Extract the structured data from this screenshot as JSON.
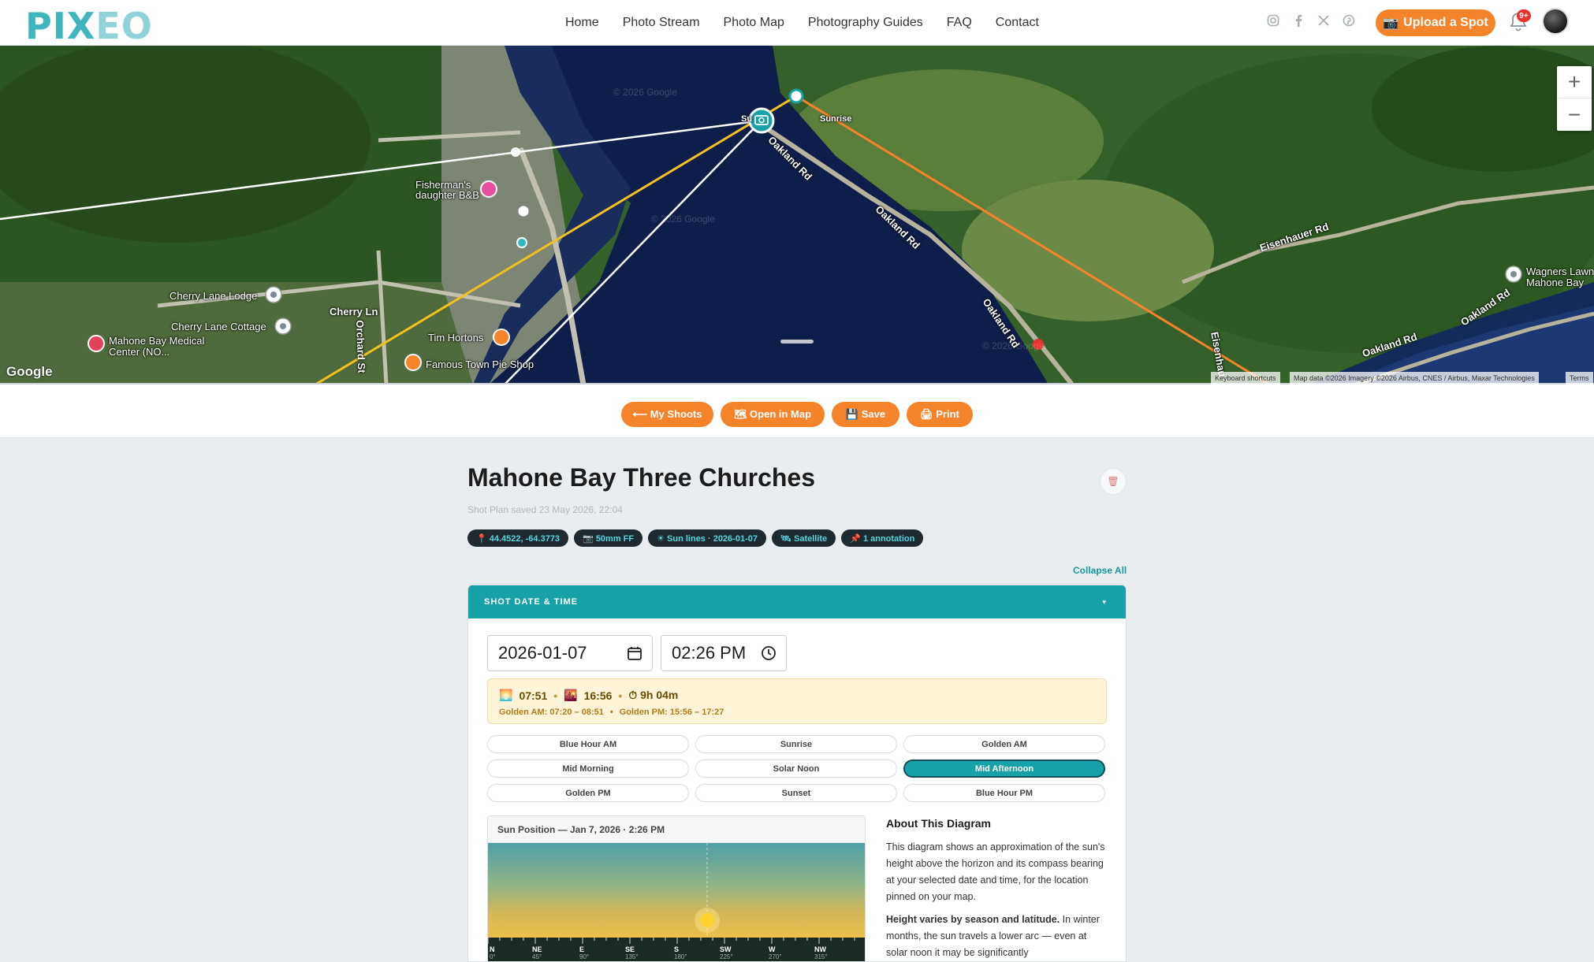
{
  "brand": {
    "logo_a": "PIX",
    "logo_b": "EO"
  },
  "nav": {
    "items": [
      "Home",
      "Photo Stream",
      "Photo Map",
      "Photography Guides",
      "FAQ",
      "Contact"
    ],
    "upload_label": "Upload a Spot",
    "notification_badge": "9+",
    "socials": [
      "instagram-icon",
      "facebook-icon",
      "x-icon",
      "pinterest-icon"
    ]
  },
  "map": {
    "labels": {
      "fishermans": "Fisherman's daughter B&B",
      "cherry_lodge": "Cherry Lane Lodge",
      "cherry_cottage": "Cherry Lane Cottage",
      "cherry_ln": "Cherry Ln",
      "orchard": "Orchard St",
      "medical": "Mahone Bay Medical Center (NO...",
      "tim": "Tim Hortons",
      "pie": "Famous Town Pie Shop",
      "sunrise": "Sunrise",
      "oakland1": "Oakland Rd",
      "oakland2": "Oakland Rd",
      "oakland3": "Oakland Rd",
      "oakland4": "Oakland Rd",
      "oakland5": "Oakland Rd",
      "eisenhauer": "Eisenhauer Rd",
      "eisenhau2": "Eisenhau",
      "wagners": "Wagners Lawn Mahone Bay",
      "sun": "Su",
      "watermark1": "© 2026 Google",
      "watermark2": "© 2026 Google",
      "watermark3": "© 2026 Google"
    },
    "google": "Google",
    "attribution": {
      "shortcuts": "Keyboard shortcuts",
      "data": "Map data ©2026 Imagery ©2026 Airbus, CNES / Airbus, Maxar Technologies",
      "terms": "Terms"
    },
    "zoom_in": "+",
    "zoom_out": "−"
  },
  "toolbar": {
    "my_shoots": "⟵ My Shoots",
    "open_map": "🗺 Open in Map",
    "save": "💾 Save",
    "print": "🖨 Print"
  },
  "plan": {
    "title": "Mahone Bay Three Churches",
    "saved": "Shot Plan saved 23 May 2026, 22:04",
    "chips": [
      "📍 44.4522, -64.3773",
      "📷 50mm FF",
      "☀ Sun lines · 2026-01-07",
      "🛰 Satellite",
      "📌 1 annotation"
    ],
    "collapse_all": "Collapse All"
  },
  "panel": {
    "heading": "SHOT DATE & TIME",
    "caret": "▾",
    "date": "2026-01-07",
    "time": "02:26 PM",
    "sunrise": "07:51",
    "sunset": "16:56",
    "daylength": "⏱ 9h 04m",
    "sep": "•",
    "golden_am": "Golden AM: 07:20 – 08:51",
    "golden_pm": "Golden PM: 15:56 – 17:27",
    "presets": [
      "Blue Hour AM",
      "Sunrise",
      "Golden AM",
      "Mid Morning",
      "Solar Noon",
      "Mid Afternoon",
      "Golden PM",
      "Sunset",
      "Blue Hour PM"
    ],
    "active_preset": "Mid Afternoon",
    "diagram_title": "Sun Position — Jan 7, 2026 · 2:26 PM",
    "compass": [
      {
        "dir": "N",
        "deg": "0°"
      },
      {
        "dir": "NE",
        "deg": "45°"
      },
      {
        "dir": "E",
        "deg": "90°"
      },
      {
        "dir": "SE",
        "deg": "135°"
      },
      {
        "dir": "S",
        "deg": "180°"
      },
      {
        "dir": "SW",
        "deg": "225°"
      },
      {
        "dir": "W",
        "deg": "270°"
      },
      {
        "dir": "NW",
        "deg": "315°"
      }
    ],
    "about_title": "About This Diagram",
    "about_p1": "This diagram shows an approximation of the sun's height above the horizon and its compass bearing at your selected date and time, for the location pinned on your map.",
    "about_p2_bold": "Height varies by season and latitude.",
    "about_p2": " In winter months, the sun travels a lower arc — even at solar noon it may be significantly"
  },
  "colors": {
    "accent": "#16a2a8",
    "orange": "#f5832a",
    "chip_bg": "#1f2a30",
    "chip_text": "#52d6df"
  }
}
